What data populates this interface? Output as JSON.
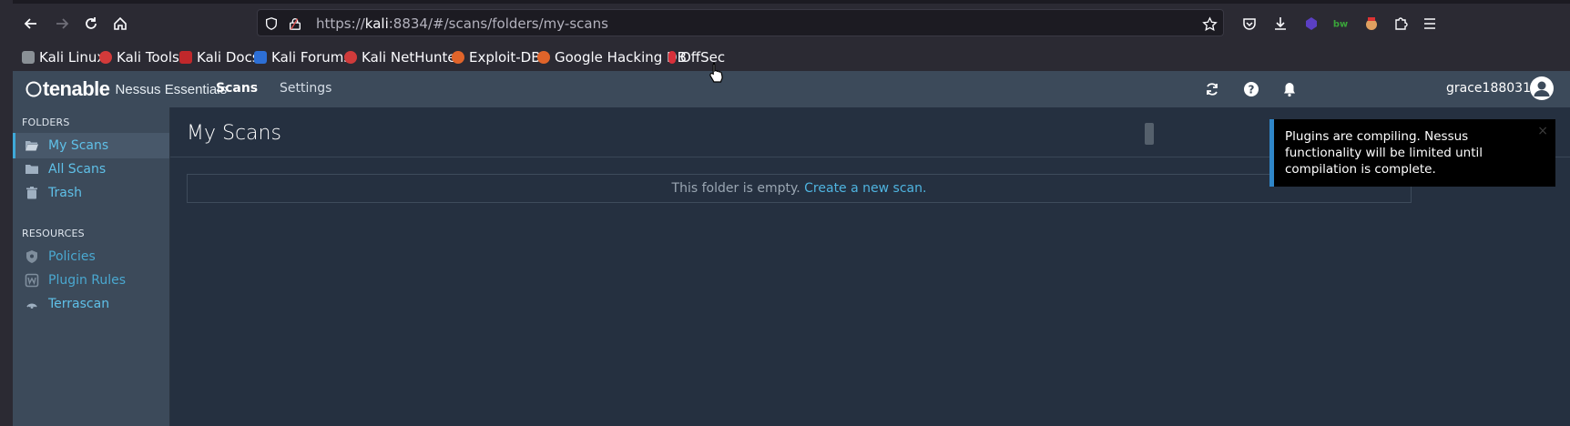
{
  "browser": {
    "url_scheme": "https://",
    "url_host": "kali",
    "url_rest": ":8834/#/scans/folders/my-scans",
    "bookmarks": [
      {
        "label": "Kali Linux",
        "icon": "kali-dragon-icon",
        "color": "#9aa0a6"
      },
      {
        "label": "Kali Tools",
        "icon": "kali-tools-icon",
        "color": "#d33a3a"
      },
      {
        "label": "Kali Docs",
        "icon": "kali-docs-icon",
        "color": "#c0282b"
      },
      {
        "label": "Kali Forums",
        "icon": "kali-forums-icon",
        "color": "#2d6fd6"
      },
      {
        "label": "Kali NetHunter",
        "icon": "nethunter-icon",
        "color": "#d03b3b"
      },
      {
        "label": "Exploit-DB",
        "icon": "exploit-db-icon",
        "color": "#e0642a"
      },
      {
        "label": "Google Hacking DB",
        "icon": "ghdb-icon",
        "color": "#e0642a"
      },
      {
        "label": "OffSec",
        "icon": "offsec-icon",
        "color": "#d8303a"
      }
    ]
  },
  "app": {
    "brand": "tenable",
    "product": "Nessus Essentials",
    "nav": {
      "scans": "Scans",
      "settings": "Settings"
    },
    "username": "grace188031"
  },
  "sidebar": {
    "folders_heading": "FOLDERS",
    "folders": [
      {
        "label": "My Scans",
        "icon": "folder-open-icon",
        "active": true
      },
      {
        "label": "All Scans",
        "icon": "folder-icon",
        "active": false
      },
      {
        "label": "Trash",
        "icon": "trash-icon",
        "active": false
      }
    ],
    "resources_heading": "RESOURCES",
    "resources": [
      {
        "label": "Policies",
        "icon": "shield-icon"
      },
      {
        "label": "Plugin Rules",
        "icon": "plugin-rules-icon"
      },
      {
        "label": "Terrascan",
        "icon": "terrascan-icon"
      }
    ]
  },
  "main": {
    "title": "My Scans",
    "empty_text": "This folder is empty.",
    "empty_link": "Create a new scan."
  },
  "toast": {
    "message": "Plugins are compiling. Nessus functionality will be limited until compilation is complete.",
    "close": "×"
  },
  "colors": {
    "accent": "#3fa9d8",
    "link": "#4fb4e0",
    "app_bg": "#253040",
    "panel_bg": "#3c4a5a"
  }
}
